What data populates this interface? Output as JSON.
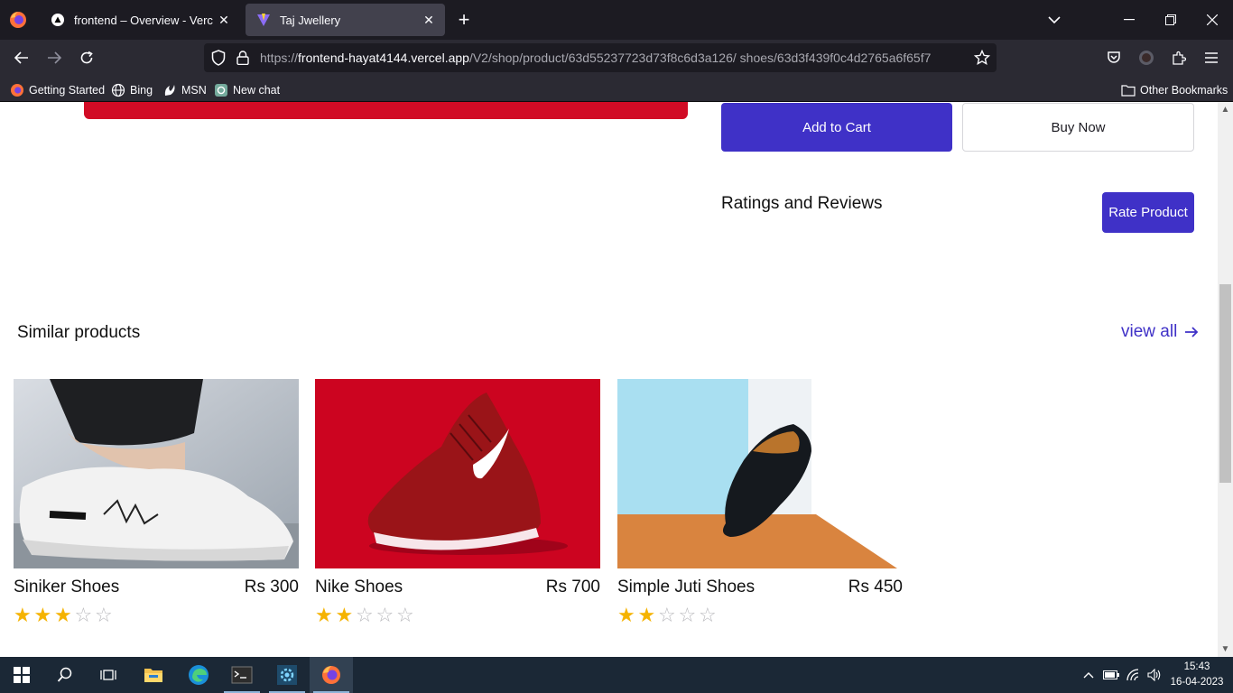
{
  "browser": {
    "tabs": [
      {
        "title": "frontend – Overview - Vercel",
        "active": false
      },
      {
        "title": "Taj Jwellery",
        "active": true
      }
    ],
    "url": {
      "prefix": "https://",
      "domain": "frontend-hayat4144.vercel.app",
      "path": "/V2/shop/product/63d55237723d73f8c6d3a126/ shoes/63d3f439f0c4d2765a6f65f7"
    },
    "bookmarks": [
      {
        "label": "Getting Started",
        "icon": "firefox-icon"
      },
      {
        "label": "Bing",
        "icon": "globe-icon"
      },
      {
        "label": "MSN",
        "icon": "msn-icon"
      },
      {
        "label": "New chat",
        "icon": "chatgpt-icon"
      }
    ],
    "other_bookmarks": "Other Bookmarks"
  },
  "product": {
    "add_to_cart": "Add to Cart",
    "buy_now": "Buy Now",
    "ratings_title": "Ratings and Reviews",
    "rate_product": "Rate Product",
    "accent_color": "#3f31c7"
  },
  "similar": {
    "title": "Similar products",
    "view_all": "view all",
    "items": [
      {
        "name": "Siniker Shoes",
        "price": "Rs 300",
        "rating": 3,
        "max_rating": 5
      },
      {
        "name": "Nike Shoes",
        "price": "Rs 700",
        "rating": 2,
        "max_rating": 5
      },
      {
        "name": "Simple Juti Shoes",
        "price": "Rs 450",
        "rating": 2,
        "max_rating": 5
      }
    ]
  },
  "taskbar": {
    "time": "15:43",
    "date": "16-04-2023"
  }
}
